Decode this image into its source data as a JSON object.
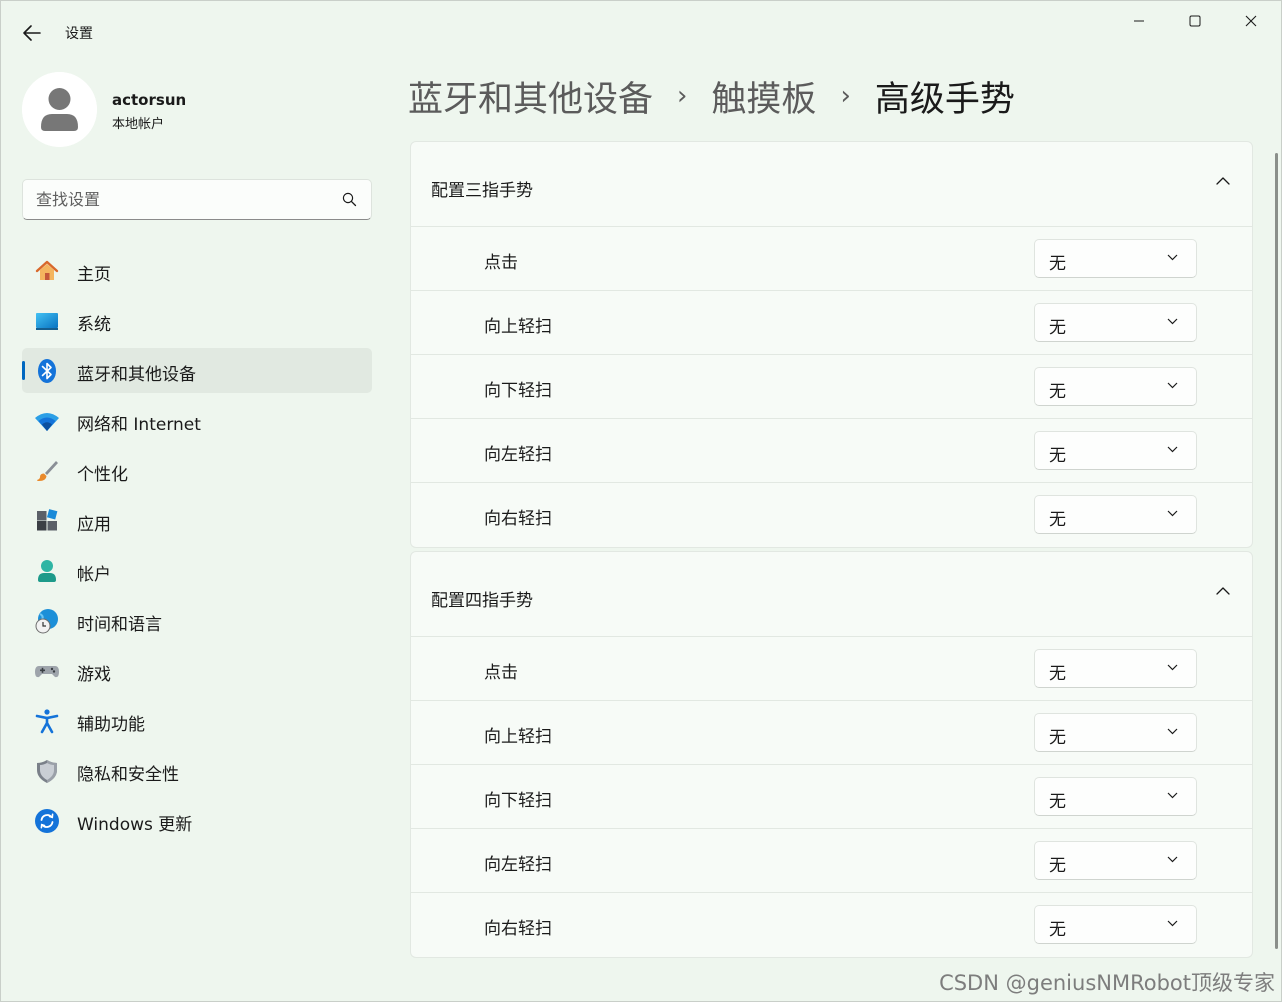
{
  "window": {
    "title": "设置",
    "controls": [
      "minimize",
      "maximize",
      "close"
    ]
  },
  "profile": {
    "name": "actorsun",
    "account_type": "本地帐户"
  },
  "search": {
    "placeholder": "查找设置",
    "value": ""
  },
  "sidebar": {
    "active_index": 2,
    "items": [
      {
        "label": "主页",
        "icon": "home-icon"
      },
      {
        "label": "系统",
        "icon": "system-icon"
      },
      {
        "label": "蓝牙和其他设备",
        "icon": "bluetooth-icon"
      },
      {
        "label": "网络和 Internet",
        "icon": "wifi-icon"
      },
      {
        "label": "个性化",
        "icon": "brush-icon"
      },
      {
        "label": "应用",
        "icon": "apps-icon"
      },
      {
        "label": "帐户",
        "icon": "account-icon"
      },
      {
        "label": "时间和语言",
        "icon": "globe-clock-icon"
      },
      {
        "label": "游戏",
        "icon": "gamepad-icon"
      },
      {
        "label": "辅助功能",
        "icon": "accessibility-icon"
      },
      {
        "label": "隐私和安全性",
        "icon": "shield-icon"
      },
      {
        "label": "Windows 更新",
        "icon": "update-icon"
      }
    ]
  },
  "breadcrumb": {
    "items": [
      "蓝牙和其他设备",
      "触摸板",
      "高级手势"
    ],
    "separator": "›"
  },
  "sections": [
    {
      "title": "配置三指手势",
      "expanded": true,
      "rows": [
        {
          "label": "点击",
          "value": "无"
        },
        {
          "label": "向上轻扫",
          "value": "无"
        },
        {
          "label": "向下轻扫",
          "value": "无"
        },
        {
          "label": "向左轻扫",
          "value": "无"
        },
        {
          "label": "向右轻扫",
          "value": "无"
        }
      ]
    },
    {
      "title": "配置四指手势",
      "expanded": true,
      "rows": [
        {
          "label": "点击",
          "value": "无"
        },
        {
          "label": "向上轻扫",
          "value": "无"
        },
        {
          "label": "向下轻扫",
          "value": "无"
        },
        {
          "label": "向左轻扫",
          "value": "无"
        },
        {
          "label": "向右轻扫",
          "value": "无"
        }
      ]
    }
  ],
  "watermark": "CSDN @geniusNMRobot顶级专家",
  "colors": {
    "accent": "#0067c0",
    "window_bg": "#eef6ee",
    "card_bg": "#f7fbf7"
  }
}
